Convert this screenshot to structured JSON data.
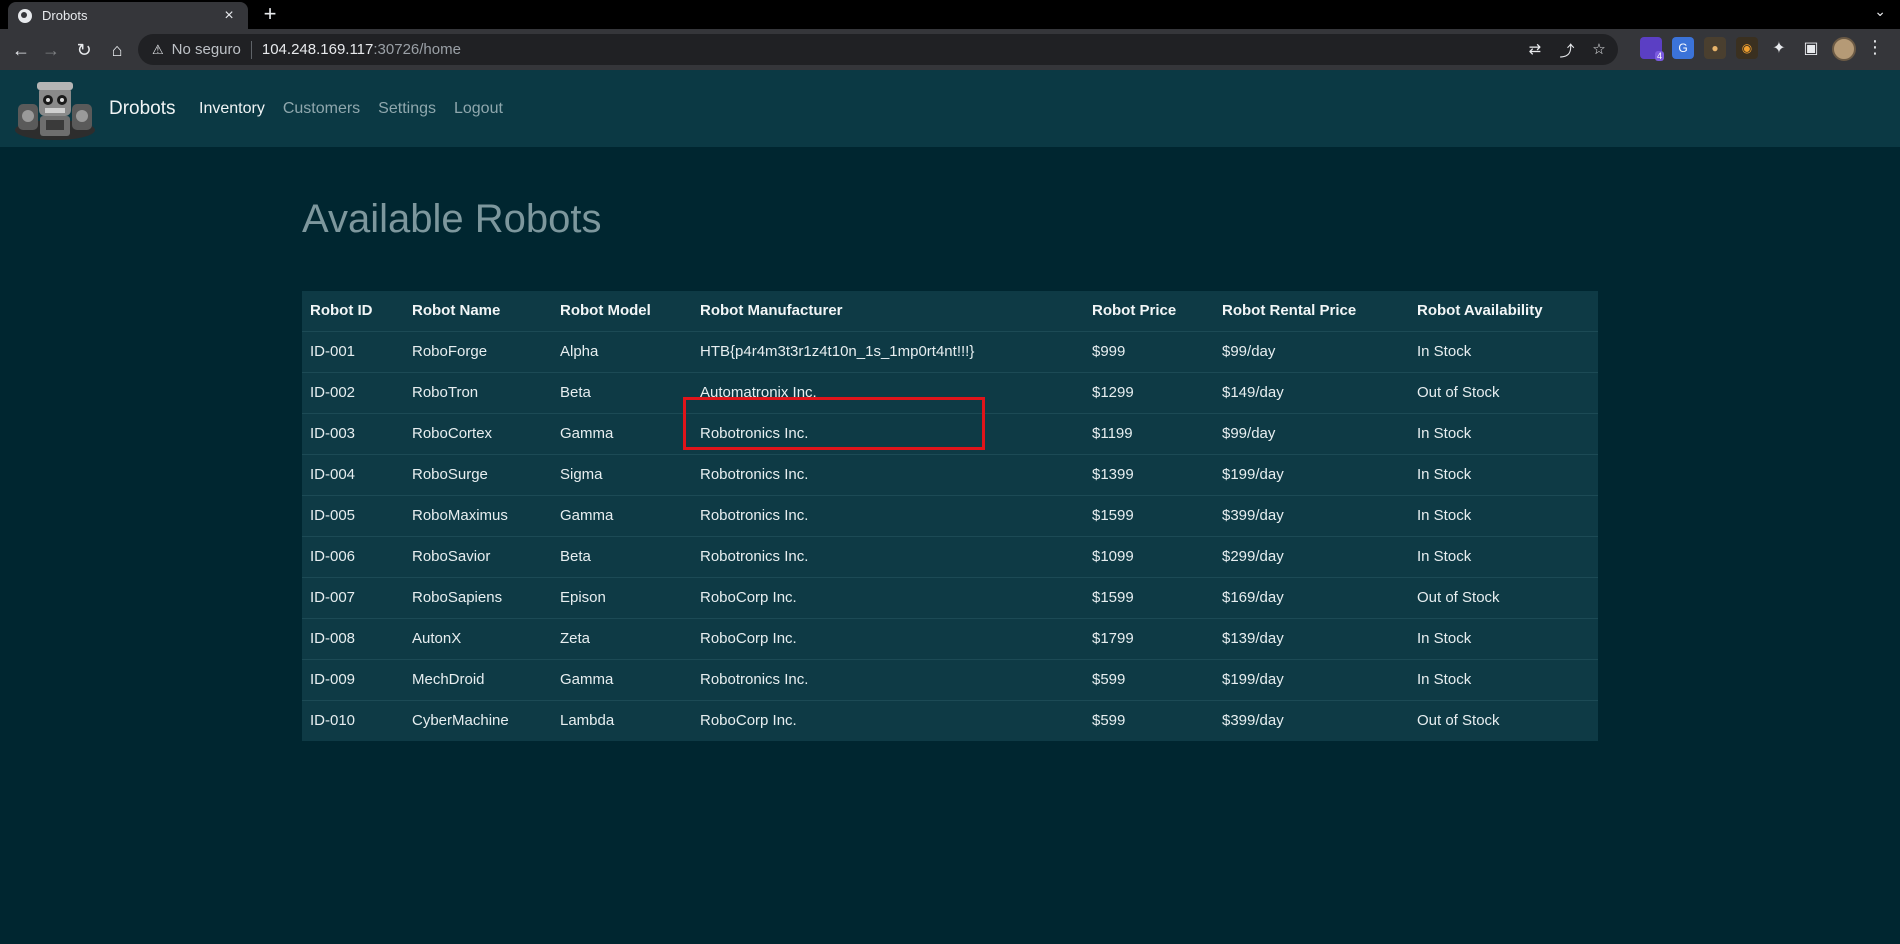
{
  "browser": {
    "tab_title": "Drobots",
    "tab_close": "×",
    "new_tab": "+",
    "tab_search": "⌄",
    "security_label": "No seguro",
    "url_host": "104.248.169.117",
    "url_path": ":30726/home",
    "ext_badge": "4"
  },
  "nav": {
    "brand": "Drobots",
    "links": [
      "Inventory",
      "Customers",
      "Settings",
      "Logout"
    ]
  },
  "main": {
    "heading": "Available Robots",
    "columns": [
      "Robot ID",
      "Robot Name",
      "Robot Model",
      "Robot Manufacturer",
      "Robot Price",
      "Robot Rental Price",
      "Robot Availability"
    ],
    "rows": [
      [
        "ID-001",
        "RoboForge",
        "Alpha",
        "HTB{p4r4m3t3r1z4t10n_1s_1mp0rt4nt!!!}",
        "$999",
        "$99/day",
        "In Stock"
      ],
      [
        "ID-002",
        "RoboTron",
        "Beta",
        "Automatronix Inc.",
        "$1299",
        "$149/day",
        "Out of Stock"
      ],
      [
        "ID-003",
        "RoboCortex",
        "Gamma",
        "Robotronics Inc.",
        "$1199",
        "$99/day",
        "In Stock"
      ],
      [
        "ID-004",
        "RoboSurge",
        "Sigma",
        "Robotronics Inc.",
        "$1399",
        "$199/day",
        "In Stock"
      ],
      [
        "ID-005",
        "RoboMaximus",
        "Gamma",
        "Robotronics Inc.",
        "$1599",
        "$399/day",
        "In Stock"
      ],
      [
        "ID-006",
        "RoboSavior",
        "Beta",
        "Robotronics Inc.",
        "$1099",
        "$299/day",
        "In Stock"
      ],
      [
        "ID-007",
        "RoboSapiens",
        "Epison",
        "RoboCorp Inc.",
        "$1599",
        "$169/day",
        "Out of Stock"
      ],
      [
        "ID-008",
        "AutonX",
        "Zeta",
        "RoboCorp Inc.",
        "$1799",
        "$139/day",
        "In Stock"
      ],
      [
        "ID-009",
        "MechDroid",
        "Gamma",
        "Robotronics Inc.",
        "$599",
        "$199/day",
        "In Stock"
      ],
      [
        "ID-010",
        "CyberMachine",
        "Lambda",
        "RoboCorp Inc.",
        "$599",
        "$399/day",
        "Out of Stock"
      ]
    ]
  },
  "colors": {
    "page_bg": "#002630",
    "navbar_bg": "#0b3944",
    "table_bg": "#0e3a45",
    "highlight": "#e0141a"
  }
}
